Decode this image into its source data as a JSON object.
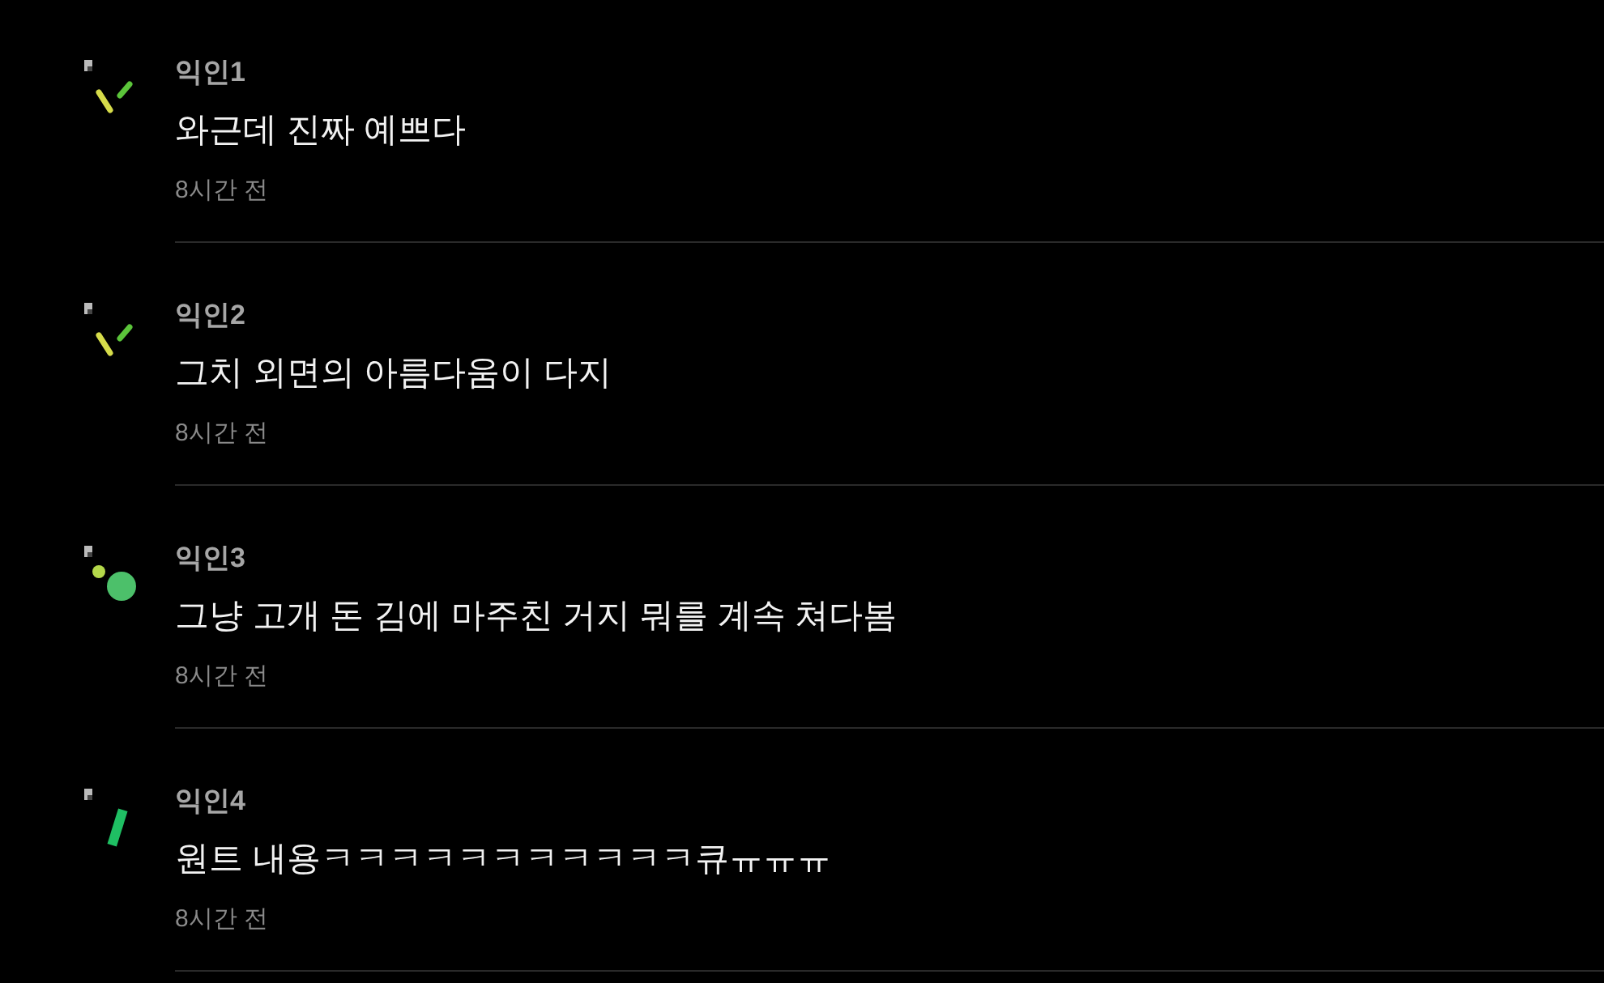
{
  "comments": [
    {
      "author": "익인1",
      "avatar": {
        "kind": "sticks"
      },
      "text": "와근데 진짜 예쁘다",
      "time": "8시간 전"
    },
    {
      "author": "익인2",
      "avatar": {
        "kind": "sticks"
      },
      "text": "그치 외면의 아름다움이 다지",
      "time": "8시간 전"
    },
    {
      "author": "익인3",
      "avatar": {
        "kind": "dots"
      },
      "text": "그냥 고개 돈 김에 마주친 거지 뭐를 계속 쳐다봄",
      "time": "8시간 전"
    },
    {
      "author": "익인4",
      "avatar": {
        "kind": "bar"
      },
      "text": "원트 내용ㅋㅋㅋㅋㅋㅋㅋㅋㅋㅋㅋ큐ㅠㅠㅠ",
      "time": "8시간 전"
    }
  ]
}
